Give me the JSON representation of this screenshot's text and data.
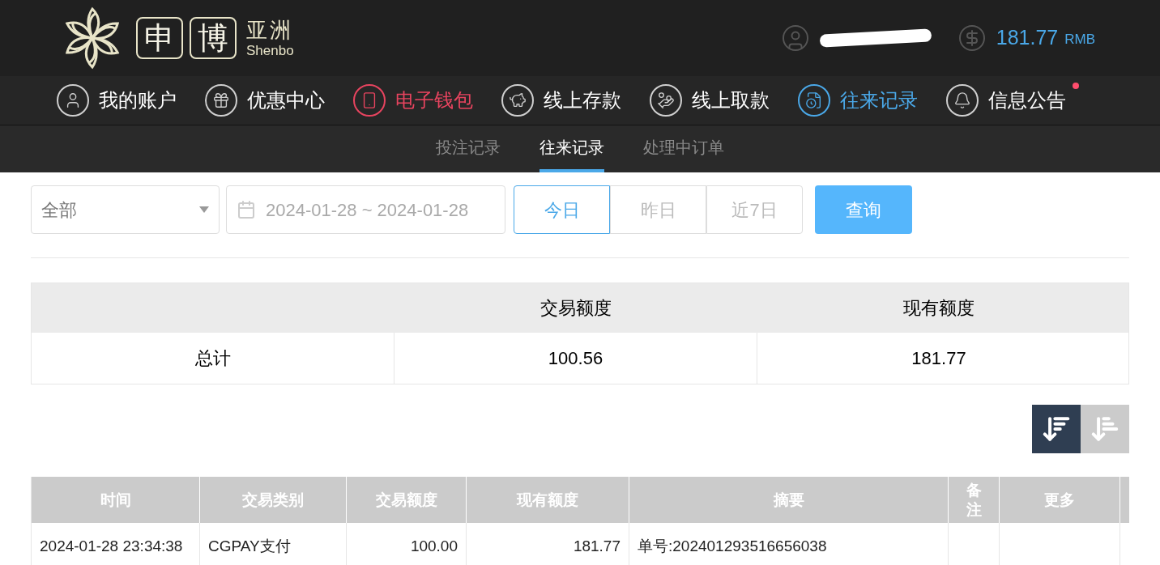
{
  "logo": {
    "chars": [
      "申",
      "博"
    ],
    "title": "亚洲",
    "latin": "Shenbo"
  },
  "account": {
    "balance": "181.77",
    "currency": "RMB"
  },
  "nav": [
    {
      "label": "我的账户",
      "color": "#ffffff"
    },
    {
      "label": "优惠中心",
      "color": "#ffffff"
    },
    {
      "label": "电子钱包",
      "color": "#e8445f"
    },
    {
      "label": "线上存款",
      "color": "#ffffff"
    },
    {
      "label": "线上取款",
      "color": "#ffffff"
    },
    {
      "label": "往来记录",
      "color": "#4aa8e8"
    },
    {
      "label": "信息公告",
      "color": "#ffffff",
      "badge": true
    }
  ],
  "subtabs": [
    {
      "label": "投注记录",
      "selected": false
    },
    {
      "label": "往来记录",
      "selected": true
    },
    {
      "label": "处理中订单",
      "selected": false
    }
  ],
  "filters": {
    "category": "全部",
    "date_range": "2024-01-28 ~ 2024-01-28",
    "ranges": [
      {
        "label": "今日",
        "selected": true
      },
      {
        "label": "昨日",
        "selected": false
      },
      {
        "label": "近7日",
        "selected": false
      }
    ],
    "query_button": "查询"
  },
  "summary": {
    "columns": [
      "交易额度",
      "现有额度"
    ],
    "row": {
      "label": "总计",
      "values": [
        "100.56",
        "181.77"
      ]
    }
  },
  "sort_buttons": [
    {
      "selected": true
    },
    {
      "selected": false
    }
  ],
  "table": {
    "columns": [
      "时间",
      "交易类别",
      "交易额度",
      "现有额度",
      "摘要",
      "备注",
      "更多"
    ],
    "rows": [
      [
        "2024-01-28 23:34:38",
        "CGPAY支付",
        "100.00",
        "181.77",
        "单号:202401293516656038",
        "",
        ""
      ]
    ]
  }
}
